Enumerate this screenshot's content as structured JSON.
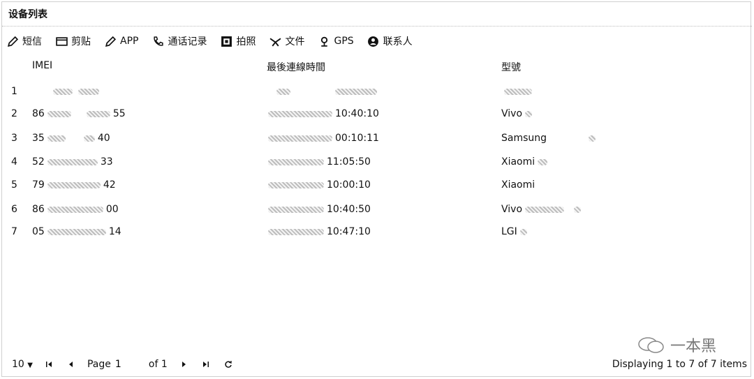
{
  "window": {
    "title": "设备列表"
  },
  "toolbar": {
    "items": [
      {
        "label": "短信",
        "icon": "pencil-icon"
      },
      {
        "label": "剪贴",
        "icon": "card-icon"
      },
      {
        "label": "APP",
        "icon": "pencil-icon"
      },
      {
        "label": "通话记录",
        "icon": "phone-icon"
      },
      {
        "label": "拍照",
        "icon": "camera-icon"
      },
      {
        "label": "文件",
        "icon": "file-icon"
      },
      {
        "label": "GPS",
        "icon": "location-pin-icon"
      },
      {
        "label": "联系人",
        "icon": "person-icon"
      }
    ]
  },
  "table": {
    "columns": [
      "IMEI",
      "最後連線時間",
      "型號"
    ],
    "rows": [
      {
        "num": "1",
        "imei_prefix": "",
        "imei_suffix": "",
        "time": "",
        "model": ""
      },
      {
        "num": "2",
        "imei_prefix": "86",
        "imei_suffix": "55",
        "time": "10:40:10",
        "model": "Vivo"
      },
      {
        "num": "3",
        "imei_prefix": "35",
        "imei_suffix": "40",
        "time": "00:10:11",
        "model": "Samsung"
      },
      {
        "num": "4",
        "imei_prefix": "52",
        "imei_suffix": "33",
        "time": "11:05:50",
        "model": "Xiaomi"
      },
      {
        "num": "5",
        "imei_prefix": "79",
        "imei_suffix": "42",
        "time": "10:00:10",
        "model": "Xiaomi"
      },
      {
        "num": "6",
        "imei_prefix": "86",
        "imei_suffix": "00",
        "time": "10:40:50",
        "model": "Vivo"
      },
      {
        "num": "7",
        "imei_prefix": "05",
        "imei_suffix": "14",
        "time": "10:47:10",
        "model": "LGI"
      }
    ]
  },
  "pagination": {
    "page_size": "10",
    "page_label": "Page",
    "page_value": "1",
    "of_label": "of 1",
    "display_text": "Displaying 1 to 7 of 7 items"
  },
  "watermark": {
    "text": "一本黑"
  }
}
